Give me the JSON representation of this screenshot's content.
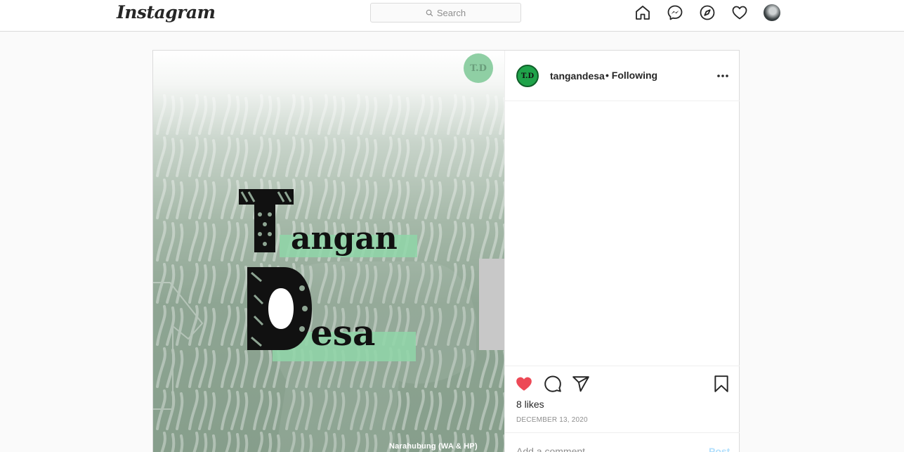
{
  "app": {
    "logo_text": "Instagram"
  },
  "search": {
    "placeholder": "Search"
  },
  "nav_icons": [
    "home-icon",
    "messenger-icon",
    "explore-icon",
    "activity-heart-icon",
    "profile-avatar"
  ],
  "post": {
    "image": {
      "badge_text": "T.D",
      "title_word_1_rest": "angan",
      "title_word_2_rest": "esa",
      "contact_text": "Narahubung (WA & HP)",
      "colors": {
        "background": "#8ea593",
        "highlight": "#8fd6a8",
        "badge": "#8fcfa4"
      }
    },
    "author": {
      "avatar_text": "T.D",
      "username": "tangandesa",
      "follow_status": "• Following"
    },
    "actions": {
      "liked": true,
      "like_color": "#ed4956",
      "icons": [
        "heart-icon",
        "comment-icon",
        "share-icon",
        "bookmark-icon"
      ]
    },
    "likes_text": "8 likes",
    "date_text": "DECEMBER 13, 2020",
    "comment": {
      "placeholder": "Add a comment...",
      "post_label": "Post"
    }
  }
}
